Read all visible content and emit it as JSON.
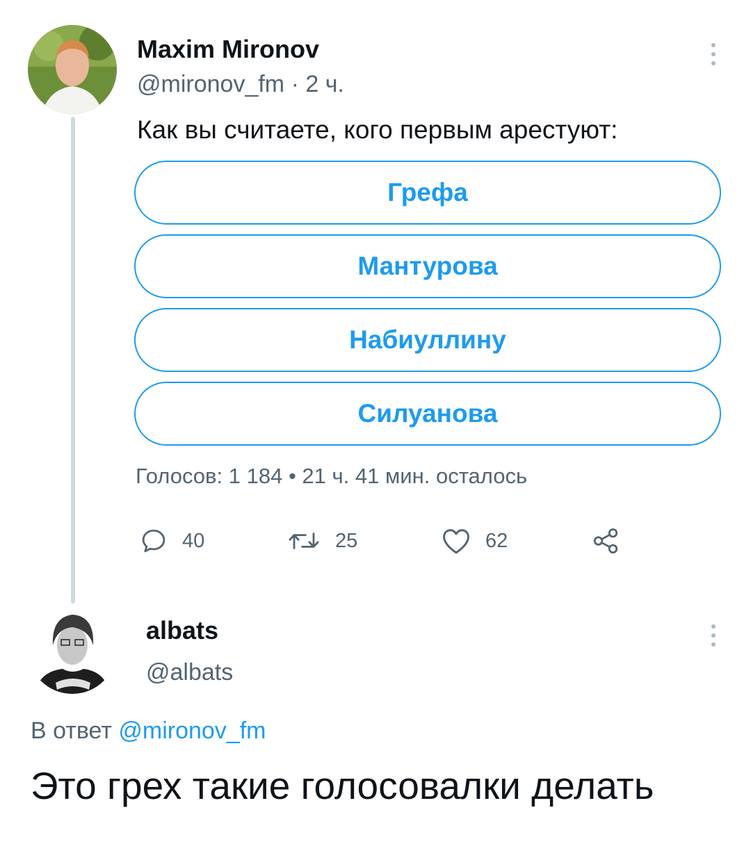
{
  "tweet": {
    "author_name": "Maxim Mironov",
    "handle": "@mironov_fm",
    "separator": "·",
    "time": "2 ч.",
    "text": "Как вы считаете, кого первым арестуют:",
    "poll": {
      "options": [
        "Грефа",
        "Мантурова",
        "Набиуллину",
        "Силуанова"
      ],
      "votes_label": "Голосов: 1 184",
      "bullet": "•",
      "remaining": "21 ч. 41 мин. осталось"
    },
    "actions": {
      "replies": "40",
      "retweets": "25",
      "likes": "62"
    }
  },
  "reply": {
    "author_name": "albats",
    "handle": "@albats",
    "reply_prefix": "В ответ",
    "reply_to_handle": "@mironov_fm",
    "text": "Это грех такие голосовалки делать"
  },
  "colors": {
    "accent": "#1d9bf0",
    "muted": "#536471",
    "thread_line": "#cfd9de"
  }
}
